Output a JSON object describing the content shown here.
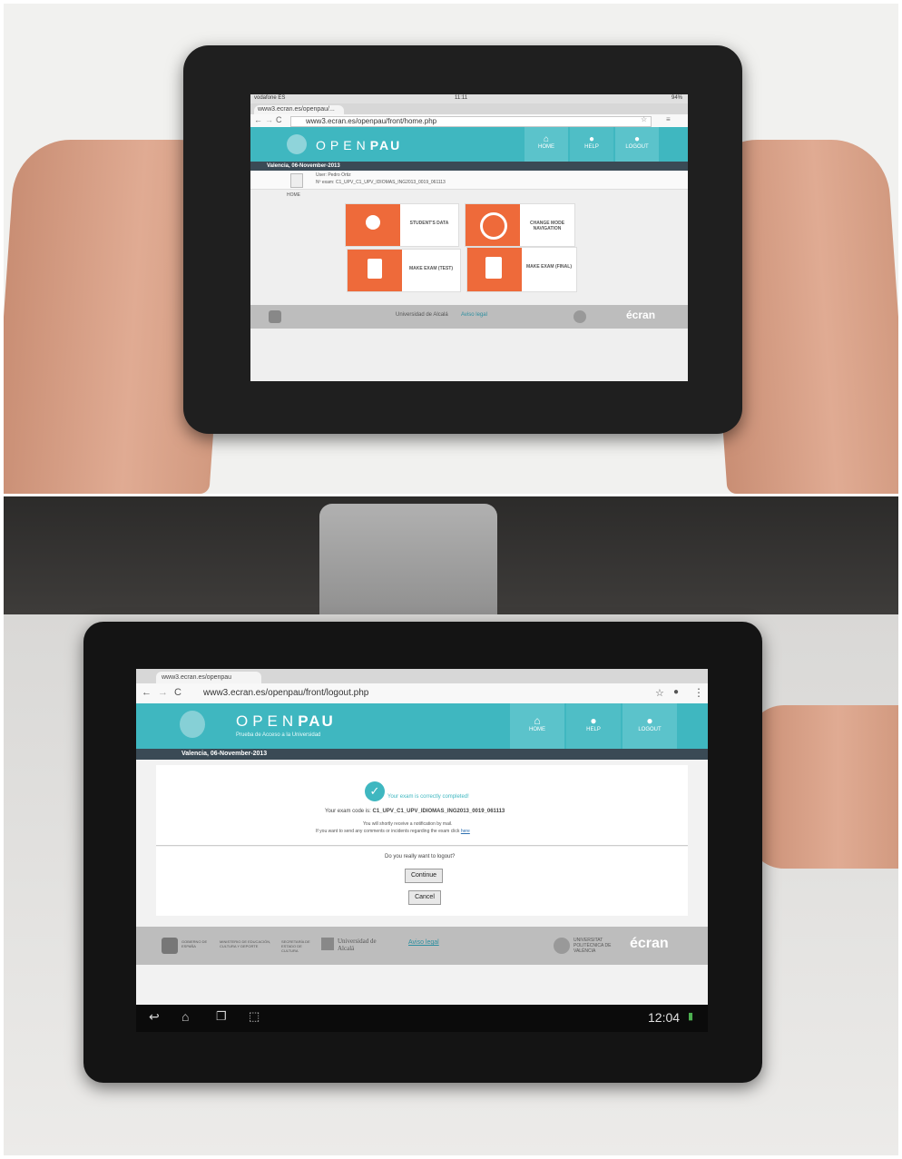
{
  "top_photo": {
    "browser": {
      "status_carrier": "vodafone ES",
      "status_time": "11:11",
      "status_battery": "94%",
      "tab_title": "www3.ecran.es/openpau/...",
      "url": "www3.ecran.es/openpau/front/home.php"
    },
    "site": {
      "logo_light": "OPEN",
      "logo_bold": "PAU",
      "nav": [
        "HOME",
        "HELP",
        "LOGOUT"
      ],
      "date": "Valencia, 06-November-2013",
      "user_line": "User: Pedro Ortiz",
      "exam_line": "Nº exam: C1_UPV_C1_UPV_IDIOMAS_ING2013_0019_061113",
      "breadcrumb": "HOME",
      "tiles": [
        {
          "label": "STUDENT'S DATA",
          "icon": "person-icon"
        },
        {
          "label": "CHANGE MODE NAVIGATION",
          "icon": "cycle-icon"
        },
        {
          "label": "MAKE EXAM (TEST)",
          "icon": "clipboard-icon"
        },
        {
          "label": "MAKE EXAM (FINAL)",
          "icon": "clipboard-check-icon"
        }
      ],
      "footer_left": "Universidad de Alcalá",
      "footer_link": "Aviso legal",
      "footer_brand": "écran"
    }
  },
  "bottom_photo": {
    "browser": {
      "tab_title": "www3.ecran.es/openpau",
      "url": "www3.ecran.es/openpau/front/logout.php"
    },
    "site": {
      "logo_light": "OPEN",
      "logo_bold": "PAU",
      "tagline": "Prueba de Acceso a la Universidad",
      "nav": [
        "HOME",
        "HELP",
        "LOGOUT"
      ],
      "date": "Valencia, 06-November-2013",
      "success_message": "Your exam is correctly completed!",
      "exam_code_label": "Your exam code is:",
      "exam_code": "C1_UPV_C1_UPV_IDIOMAS_ING2013_0019_061113",
      "notify_line": "You will shortly receive a notification by mail.",
      "comments_line": "If you want to send any comments or incidents regarding the exam click",
      "comments_link": "here",
      "logout_question": "Do you really want to logout?",
      "continue_label": "Continue",
      "cancel_label": "Cancel",
      "footer_ministry": "GOBIERNO DE ESPAÑA",
      "footer_ministry2": "MINISTERIO DE EDUCACIÓN, CULTURA Y DEPORTE",
      "footer_secretaria": "SECRETARÍA DE ESTADO DE CULTURA",
      "footer_uah": "Universidad de Alcalá",
      "footer_link": "Aviso legal",
      "footer_upv": "UNIVERSITAT POLITÈCNICA DE VALÈNCIA",
      "footer_brand": "écran"
    },
    "android_time": "12:04"
  },
  "colors": {
    "teal": "#3fb7c0",
    "orange": "#ee6a3a",
    "date_bar": "#3a4a55"
  }
}
